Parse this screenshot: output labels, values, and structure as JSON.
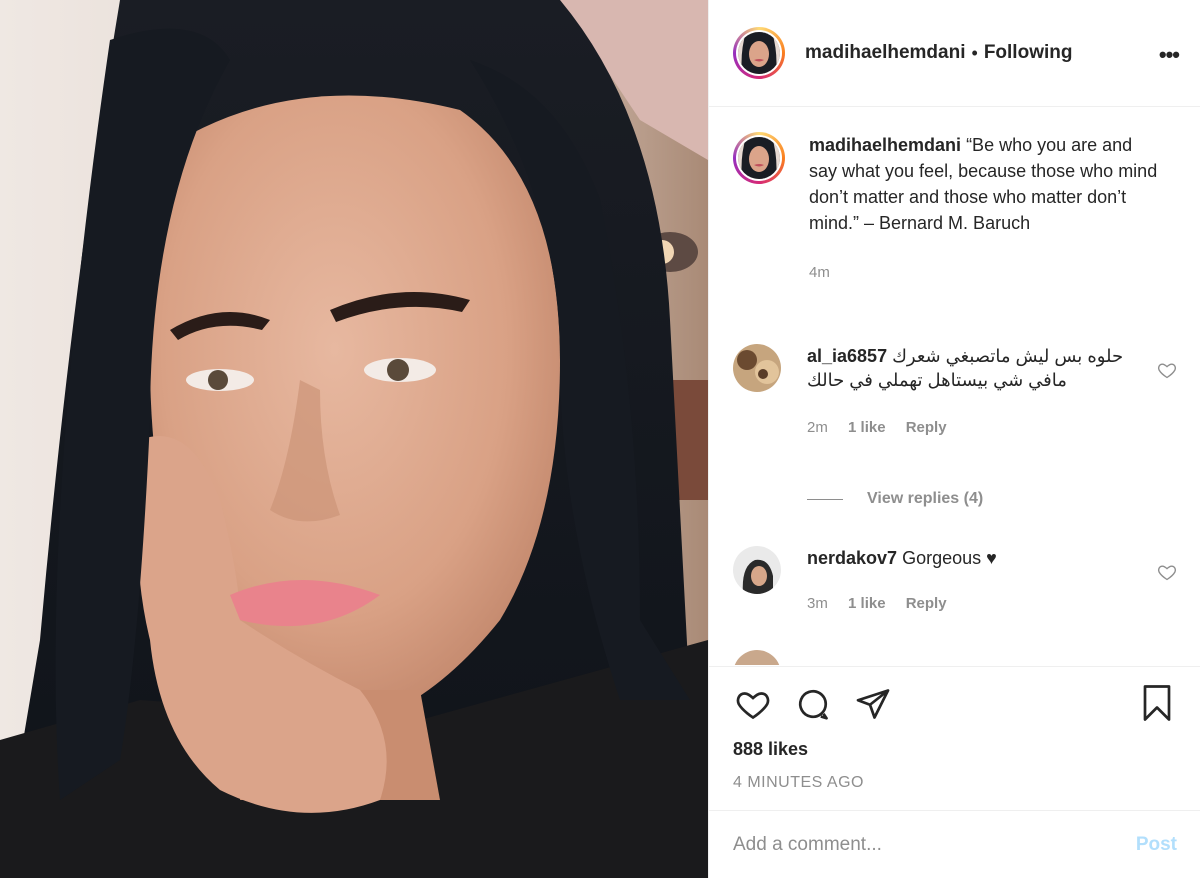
{
  "header": {
    "username": "madihaelhemdani",
    "separator": "•",
    "follow_status": "Following",
    "more_icon": "more-horizontal-icon"
  },
  "caption": {
    "username": "madihaelhemdani",
    "text": "“Be who you are and say what you feel, because those who mind don’t matter and those who matter don’t mind.” – Bernard M. Baruch",
    "time": "4m"
  },
  "comments": [
    {
      "username": "al_ia6857",
      "text": "حلوه بس ليش ماتصبغي شعرك مافي شي بيستاهل تهملي في حالك",
      "time": "2m",
      "likes": "1 like",
      "reply": "Reply"
    },
    {
      "username": "nerdakov7",
      "text": "Gorgeous ♥",
      "time": "3m",
      "likes": "1 like",
      "reply": "Reply"
    }
  ],
  "view_replies": "View replies (4)",
  "actions": {
    "like_icon": "heart-icon",
    "comment_icon": "comment-icon",
    "share_icon": "paper-plane-icon",
    "save_icon": "bookmark-icon",
    "likes_count": "888 likes",
    "posted_ago": "4 MINUTES AGO"
  },
  "comment_box": {
    "placeholder": "Add a comment...",
    "post_label": "Post"
  },
  "colors": {
    "text": "#262626",
    "muted": "#8e8e8e",
    "post_disabled": "#b2dffc",
    "border": "#efefef"
  }
}
